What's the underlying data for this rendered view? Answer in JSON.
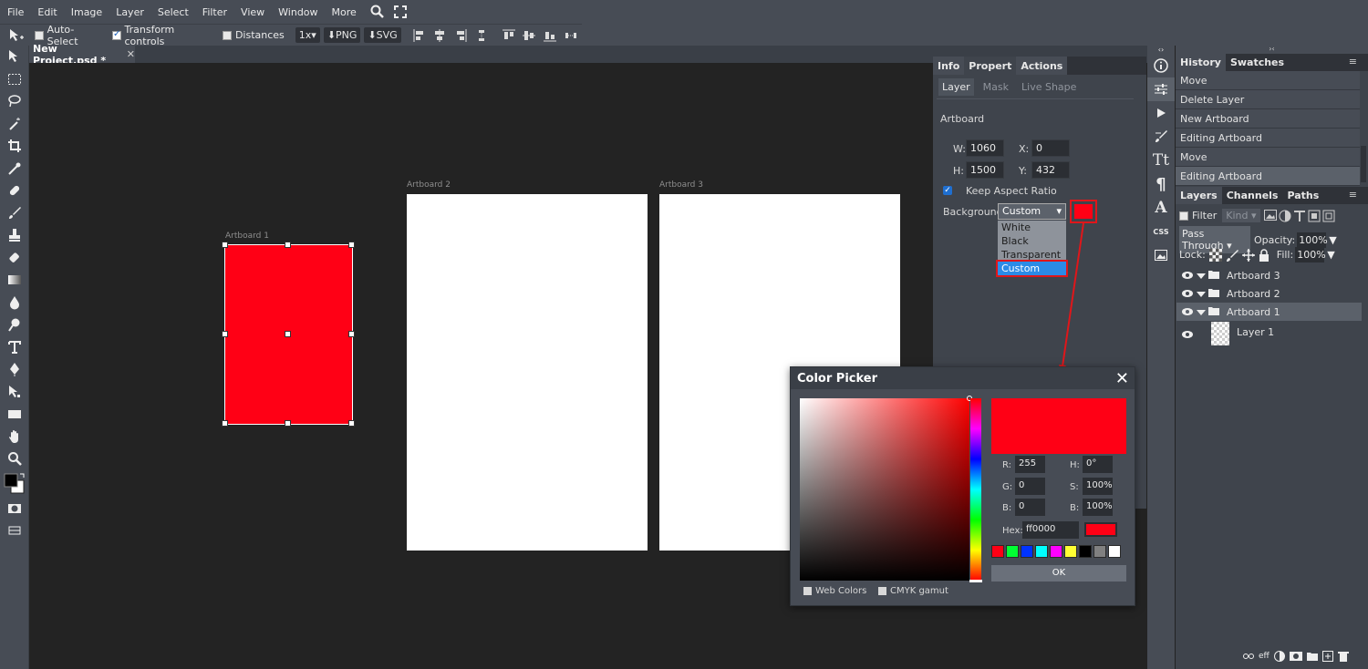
{
  "menu": {
    "items": [
      "File",
      "Edit",
      "Image",
      "Layer",
      "Select",
      "Filter",
      "View",
      "Window",
      "More"
    ]
  },
  "options": {
    "auto_select": "Auto-Select",
    "transform_controls": "Transform controls",
    "distances": "Distances",
    "scale": "1x",
    "png": "PNG",
    "svg": "SVG"
  },
  "document": {
    "tab_title": "New Project.psd *",
    "close": "✕"
  },
  "artboards": [
    {
      "label": "Artboard 1",
      "color": "#ff0015"
    },
    {
      "label": "Artboard 2",
      "color": "#ffffff"
    },
    {
      "label": "Artboard 3",
      "color": "#ffffff"
    }
  ],
  "properties": {
    "tabs": [
      "Info",
      "Propert",
      "Actions"
    ],
    "subtabs": [
      "Layer",
      "Mask",
      "Live Shape"
    ],
    "section": "Artboard",
    "w_label": "W:",
    "w_value": "1060",
    "x_label": "X:",
    "x_value": "0",
    "h_label": "H:",
    "h_value": "1500",
    "y_label": "Y:",
    "y_value": "432",
    "keep_aspect": "Keep Aspect Ratio",
    "background_label": "Background:",
    "background_value": "Custom",
    "background_options": [
      "White",
      "Black",
      "Transparent",
      "Custom"
    ],
    "swatch_color": "#ff0015"
  },
  "history": {
    "tabs": [
      "History",
      "Swatches"
    ],
    "items": [
      "Move",
      "Delete Layer",
      "New Artboard",
      "Editing Artboard",
      "Move",
      "Editing Artboard"
    ]
  },
  "layers": {
    "tabs": [
      "Layers",
      "Channels",
      "Paths"
    ],
    "filter": "Filter",
    "kind": "Kind",
    "blend_mode": "Pass Through",
    "opacity_label": "Opacity:",
    "opacity_value": "100%",
    "lock_label": "Lock:",
    "fill_label": "Fill:",
    "fill_value": "100%",
    "rows": [
      "Artboard 3",
      "Artboard 2",
      "Artboard 1",
      "Layer 1"
    ],
    "footer": "eff"
  },
  "color_picker": {
    "title": "Color Picker",
    "r_label": "R:",
    "r": "255",
    "g_label": "G:",
    "g": "0",
    "b_label": "B:",
    "b": "0",
    "h_label": "H:",
    "h": "0°",
    "s_label": "S:",
    "s": "100%",
    "bv_label": "B:",
    "bv": "100%",
    "hex_label": "Hex:",
    "hex": "ff0000",
    "ok": "OK",
    "web_colors": "Web Colors",
    "cmyk": "CMYK gamut",
    "current_color": "#ff0015",
    "palette": [
      "#ff0015",
      "#00ff33",
      "#0033ff",
      "#00ffff",
      "#ff00ff",
      "#ffff33",
      "#000000",
      "#808080",
      "#ffffff"
    ]
  },
  "strip_icons": [
    "info-icon",
    "sliders-icon",
    "play-icon",
    "brush-settings-icon",
    "type-icon",
    "paragraph-icon",
    "glyph-icon",
    "css-icon",
    "image-icon"
  ],
  "strip_css": "CSS"
}
